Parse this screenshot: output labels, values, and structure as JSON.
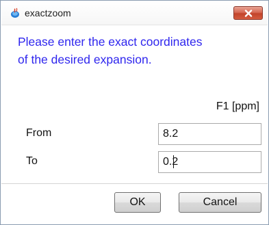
{
  "window": {
    "title": "exactzoom",
    "app_icon": "java-cup-icon",
    "close_icon": "close-icon",
    "close_button_color": "#c2442b"
  },
  "dialog": {
    "message_line1": "Please enter the exact coordinates",
    "message_line2": "of the desired expansion.",
    "message_color": "#2f26ee",
    "column_header": "F1 [ppm]",
    "rows": [
      {
        "label": "From",
        "value": "8.2"
      },
      {
        "label": "To",
        "value": "0.2"
      }
    ]
  },
  "buttons": {
    "ok_label": "OK",
    "cancel_label": "Cancel"
  }
}
